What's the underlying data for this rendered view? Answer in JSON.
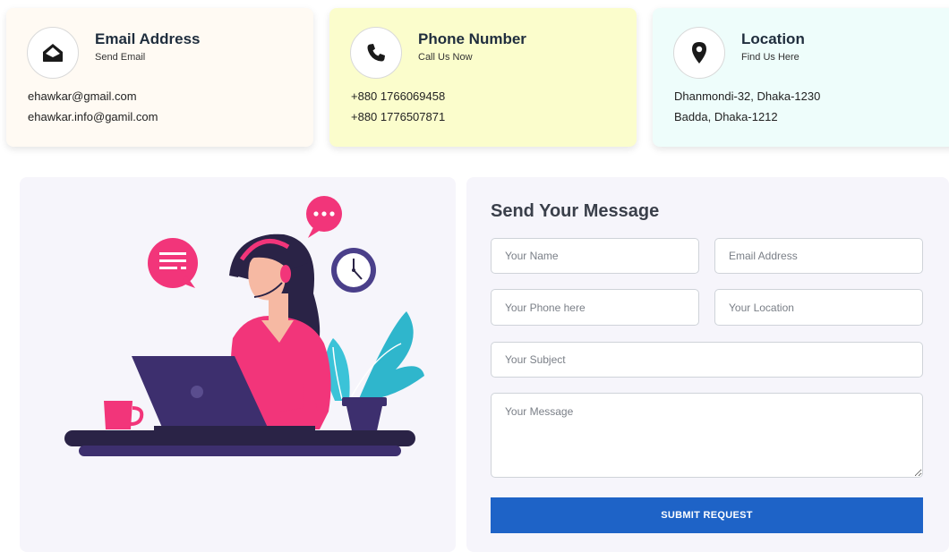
{
  "cards": [
    {
      "title": "Email Address",
      "subtitle": "Send Email",
      "lines": [
        "ehawkar@gmail.com",
        "ehawkar.info@gamil.com"
      ],
      "bg": "#fffaf3",
      "icon": "envelope-icon"
    },
    {
      "title": "Phone Number",
      "subtitle": "Call Us Now",
      "lines": [
        "+880 1766069458",
        "+880 1776507871"
      ],
      "bg": "#fbfdcc",
      "icon": "phone-icon"
    },
    {
      "title": "Location",
      "subtitle": "Find Us Here",
      "lines": [
        "Dhanmondi-32, Dhaka-1230",
        "Badda, Dhaka-1212"
      ],
      "bg": "#eefdfb",
      "icon": "map-pin-icon"
    }
  ],
  "form": {
    "title": "Send Your Message",
    "name_placeholder": "Your Name",
    "email_placeholder": "Email Address",
    "phone_placeholder": "Your Phone here",
    "location_placeholder": "Your Location",
    "subject_placeholder": "Your Subject",
    "message_placeholder": "Your Message",
    "submit_label": "SUBMIT REQUEST"
  },
  "colors": {
    "accent": "#1e63c7",
    "panel_bg": "#f6f5fb",
    "illustration_pink": "#f2357a",
    "illustration_navy": "#2a2346",
    "illustration_teal": "#3bc3d8"
  }
}
